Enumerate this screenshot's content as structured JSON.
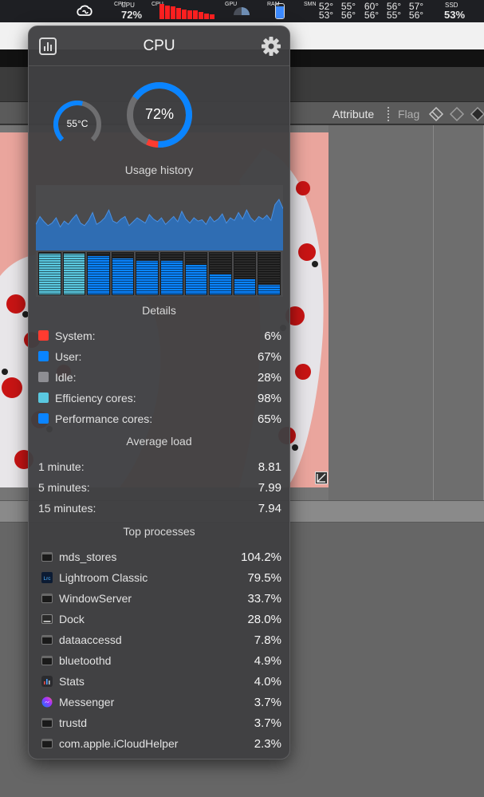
{
  "menubar": {
    "cpu_stack": "CPU",
    "cpu_small": "CPU",
    "cpu_value": "72%",
    "cpu_bars_stack": "CPU",
    "cpu_bars": [
      0.95,
      0.85,
      0.8,
      0.7,
      0.6,
      0.55,
      0.55,
      0.45,
      0.35,
      0.3
    ],
    "gpu_stack": "GPU",
    "ram_stack": "RAM",
    "ram_level": 0.85,
    "sensors_stack": "SMN",
    "temps": [
      [
        "52°",
        "53°"
      ],
      [
        "55°",
        "56°"
      ],
      [
        "60°",
        "56°"
      ],
      [
        "56°",
        "55°"
      ],
      [
        "57°",
        "56°"
      ]
    ],
    "ssd_label": "SSD",
    "ssd_value": "53%"
  },
  "lightroom": {
    "attribute_label": "Attribute",
    "flag_label": "Flag"
  },
  "popup": {
    "title": "CPU",
    "temperature": "55°C",
    "temperature_level": 0.55,
    "usage": "72%",
    "usage_level": 0.72,
    "usage_history_title": "Usage history",
    "history_series": [
      0.4,
      0.52,
      0.44,
      0.38,
      0.42,
      0.5,
      0.36,
      0.45,
      0.4,
      0.48,
      0.55,
      0.42,
      0.38,
      0.46,
      0.58,
      0.4,
      0.44,
      0.5,
      0.62,
      0.45,
      0.42,
      0.48,
      0.52,
      0.38,
      0.44,
      0.5,
      0.46,
      0.42,
      0.55,
      0.48,
      0.44,
      0.5,
      0.4,
      0.46,
      0.52,
      0.44,
      0.6,
      0.48,
      0.42,
      0.5,
      0.45,
      0.47,
      0.4,
      0.52,
      0.44,
      0.48,
      0.56,
      0.42,
      0.5,
      0.46,
      0.58,
      0.48,
      0.62,
      0.5,
      0.44,
      0.52,
      0.48,
      0.54,
      0.46,
      0.7,
      0.78,
      0.64
    ],
    "cores": [
      {
        "level": 0.98,
        "type": "efficiency"
      },
      {
        "level": 0.98,
        "type": "efficiency"
      },
      {
        "level": 0.92,
        "type": "performance"
      },
      {
        "level": 0.86,
        "type": "performance"
      },
      {
        "level": 0.8,
        "type": "performance"
      },
      {
        "level": 0.8,
        "type": "performance"
      },
      {
        "level": 0.72,
        "type": "performance"
      },
      {
        "level": 0.48,
        "type": "performance"
      },
      {
        "level": 0.36,
        "type": "performance"
      },
      {
        "level": 0.24,
        "type": "performance"
      }
    ],
    "details_title": "Details",
    "details": [
      {
        "label": "System:",
        "value": "6%",
        "color": "#ff3b30"
      },
      {
        "label": "User:",
        "value": "67%",
        "color": "#0a84ff"
      },
      {
        "label": "Idle:",
        "value": "28%",
        "color": "#8e8e93"
      },
      {
        "label": "Efficiency cores:",
        "value": "98%",
        "color": "#5ac8e0"
      },
      {
        "label": "Performance cores:",
        "value": "65%",
        "color": "#0a84ff"
      }
    ],
    "average_load_title": "Average load",
    "average_load": [
      {
        "label": "1 minute:",
        "value": "8.81"
      },
      {
        "label": "5 minutes:",
        "value": "7.99"
      },
      {
        "label": "15 minutes:",
        "value": "7.94"
      }
    ],
    "top_processes_title": "Top processes",
    "processes": [
      {
        "name": "mds_stores",
        "value": "104.2%",
        "icon": "terminal-icon"
      },
      {
        "name": "Lightroom Classic",
        "value": "79.5%",
        "icon": "lightroom-icon",
        "icon_text": "Lrc"
      },
      {
        "name": "WindowServer",
        "value": "33.7%",
        "icon": "terminal-icon"
      },
      {
        "name": "Dock",
        "value": "28.0%",
        "icon": "dock-icon"
      },
      {
        "name": "dataaccessd",
        "value": "7.8%",
        "icon": "terminal-icon"
      },
      {
        "name": "bluetoothd",
        "value": "4.9%",
        "icon": "terminal-icon"
      },
      {
        "name": "Stats",
        "value": "4.0%",
        "icon": "stats-icon"
      },
      {
        "name": "Messenger",
        "value": "3.7%",
        "icon": "messenger-icon"
      },
      {
        "name": "trustd",
        "value": "3.7%",
        "icon": "terminal-icon"
      },
      {
        "name": "com.apple.iCloudHelper",
        "value": "2.3%",
        "icon": "terminal-icon"
      }
    ],
    "colors": {
      "accent_blue": "#0a84ff",
      "red": "#ff3b30",
      "efficiency": "#5ac8e0",
      "history_fill": "#2f6db3"
    }
  }
}
